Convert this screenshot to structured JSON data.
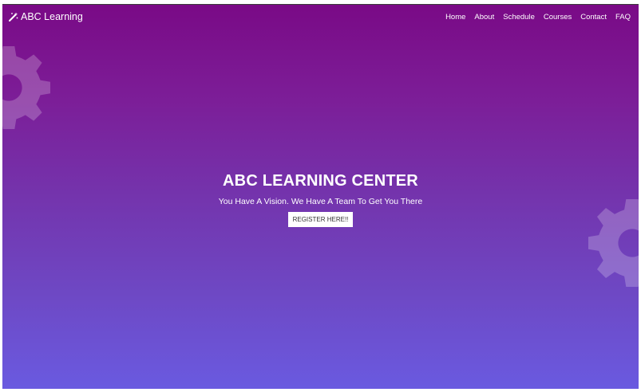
{
  "navbar": {
    "brand": {
      "icon": "magic-wand-icon",
      "label": "ABC Learning"
    },
    "links": [
      {
        "label": "Home"
      },
      {
        "label": "About"
      },
      {
        "label": "Schedule"
      },
      {
        "label": "Courses"
      },
      {
        "label": "Contact"
      },
      {
        "label": "FAQ"
      }
    ]
  },
  "hero": {
    "title": "ABC LEARNING CENTER",
    "subtitle": "You Have A Vision. We Have A Team To Get You There",
    "cta_label": "REGISTER HERE!!"
  },
  "decorations": {
    "left_icon": "gear-icon",
    "right_icon": "gear-icon"
  },
  "colors": {
    "gradient_top": "#7a0a86",
    "gradient_bottom": "#6a5ae0",
    "text": "#ffffff",
    "button_bg": "#ffffff",
    "button_text": "#333333"
  }
}
